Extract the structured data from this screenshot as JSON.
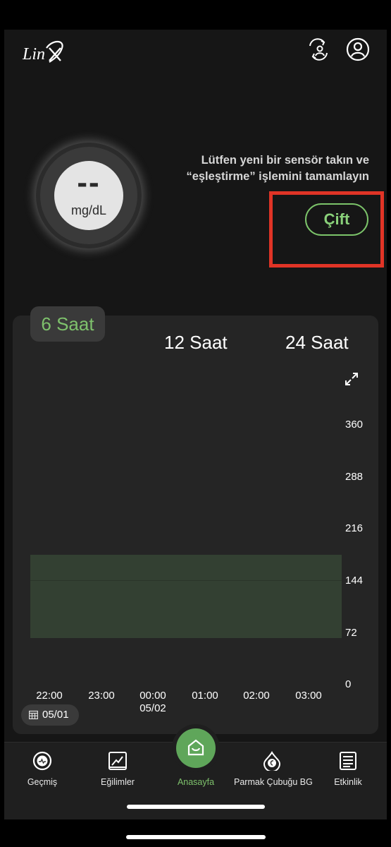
{
  "header": {
    "logo_text": "Linx",
    "icons": [
      "switch-user-icon",
      "profile-icon"
    ]
  },
  "glucose": {
    "value": "--",
    "unit": "mg/dL"
  },
  "sensor_prompt": {
    "line1": "Lütfen yeni bir sensör takın ve",
    "line2": "“eşleştirme” işlemini tamamlayın",
    "pair_button": "Çift",
    "highlight_color": "#e03426"
  },
  "chart": {
    "tabs": [
      "6 Saat",
      "12 Saat",
      "24 Saat"
    ],
    "active_tab": "6 Saat",
    "date_chip": "05/01",
    "accent_color": "#7ec16c"
  },
  "chart_data": {
    "type": "line",
    "x_ticks": [
      "22:00",
      "23:00",
      "00:00",
      "01:00",
      "02:00",
      "03:00"
    ],
    "x_date_label": "05/02",
    "y_ticks": [
      "360",
      "288",
      "216",
      "144",
      "72",
      "0"
    ],
    "ylim": [
      0,
      360
    ],
    "target_range": [
      54,
      180
    ],
    "series": []
  },
  "nav": {
    "items": [
      {
        "label": "Geçmiş",
        "icon": "history-icon"
      },
      {
        "label": "Eğilimler",
        "icon": "trends-icon"
      },
      {
        "label": "Anasayfa",
        "icon": "home-icon"
      },
      {
        "label": "Parmak Çubuğu BG",
        "icon": "finger-stick-icon"
      },
      {
        "label": "Etkinlik",
        "icon": "events-icon"
      }
    ],
    "active": "Anasayfa"
  }
}
